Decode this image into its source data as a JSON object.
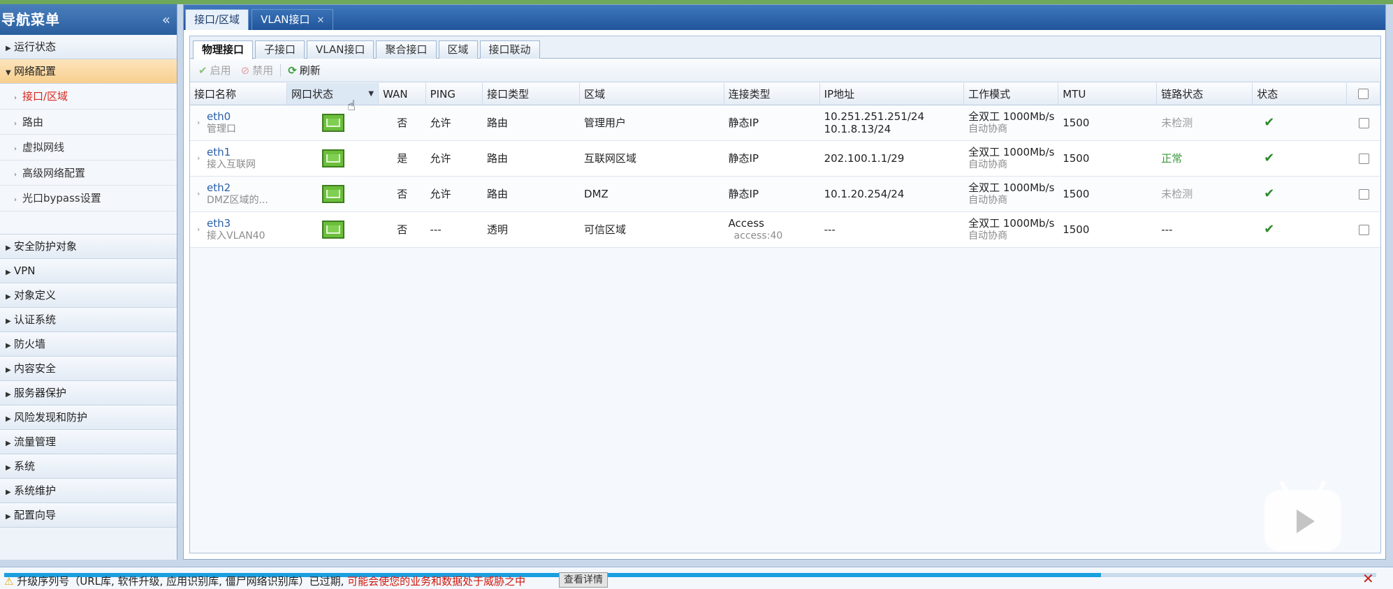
{
  "sidebar": {
    "title": "导航菜单",
    "collapse_glyph": "«",
    "groups_top": [
      {
        "label": "运行状态",
        "open": false
      },
      {
        "label": "网络配置",
        "open": true
      }
    ],
    "subitems": [
      {
        "label": "接口/区域",
        "active": true
      },
      {
        "label": "路由",
        "active": false
      },
      {
        "label": "虚拟网线",
        "active": false
      },
      {
        "label": "高级网络配置",
        "active": false
      },
      {
        "label": "光口bypass设置",
        "active": false
      }
    ],
    "groups_bottom": [
      {
        "label": "安全防护对象"
      },
      {
        "label": "VPN"
      },
      {
        "label": "对象定义"
      },
      {
        "label": "认证系统"
      },
      {
        "label": "防火墙"
      },
      {
        "label": "内容安全"
      },
      {
        "label": "服务器保护"
      },
      {
        "label": "风险发现和防护"
      },
      {
        "label": "流量管理"
      },
      {
        "label": "系统"
      },
      {
        "label": "系统维护"
      },
      {
        "label": "配置向导"
      }
    ]
  },
  "outer_tabs": [
    {
      "label": "接口/区域",
      "active": true,
      "closable": false
    },
    {
      "label": "VLAN接口",
      "active": false,
      "closable": true
    }
  ],
  "inner_tabs": [
    "物理接口",
    "子接口",
    "VLAN接口",
    "聚合接口",
    "区域",
    "接口联动"
  ],
  "toolbar": {
    "enable_label": "启用",
    "disable_label": "禁用",
    "refresh_label": "刷新"
  },
  "table": {
    "headers": [
      "接口名称",
      "网口状态",
      "WAN",
      "PING",
      "接口类型",
      "区域",
      "连接类型",
      "IP地址",
      "工作模式",
      "MTU",
      "链路状态",
      "状态"
    ],
    "rows": [
      {
        "name": "eth0",
        "desc": "管理口",
        "wan": "否",
        "ping": "允许",
        "type": "路由",
        "zone": "管理用户",
        "conn": "静态IP",
        "conn_sub": "",
        "ip1": "10.251.251.251/24",
        "ip2": "10.1.8.13/24",
        "mode": "全双工 1000Mb/s",
        "mode_sub": "自动协商",
        "mtu": "1500",
        "link": "未检测",
        "link_state": "na"
      },
      {
        "name": "eth1",
        "desc": "接入互联网",
        "wan": "是",
        "ping": "允许",
        "type": "路由",
        "zone": "互联网区域",
        "conn": "静态IP",
        "conn_sub": "",
        "ip1": "202.100.1.1/29",
        "ip2": "",
        "mode": "全双工 1000Mb/s",
        "mode_sub": "自动协商",
        "mtu": "1500",
        "link": "正常",
        "link_state": "ok"
      },
      {
        "name": "eth2",
        "desc": "DMZ区域的...",
        "wan": "否",
        "ping": "允许",
        "type": "路由",
        "zone": "DMZ",
        "conn": "静态IP",
        "conn_sub": "",
        "ip1": "10.1.20.254/24",
        "ip2": "",
        "mode": "全双工 1000Mb/s",
        "mode_sub": "自动协商",
        "mtu": "1500",
        "link": "未检测",
        "link_state": "na"
      },
      {
        "name": "eth3",
        "desc": "接入VLAN40",
        "wan": "否",
        "ping": "---",
        "type": "透明",
        "zone": "可信区域",
        "conn": "Access",
        "conn_sub": "access:40",
        "ip1": "---",
        "ip2": "",
        "mode": "全双工 1000Mb/s",
        "mode_sub": "自动协商",
        "mtu": "1500",
        "link": "---",
        "link_state": "none"
      }
    ]
  },
  "bottom_bar": {
    "warning_text": "升级序列号（URL库, 软件升级, 应用识别库, 僵尸网络识别库）已过期,",
    "warning_red": "可能会使您的业务和数据处于威胁之中",
    "detail_button": "查看详情",
    "progress": 0.8
  },
  "colors": {
    "header_blue": "#2a5e9e",
    "active_red": "#d9261c",
    "ok_green": "#3a9a3a",
    "progress_blue": "#1a9fe0"
  }
}
